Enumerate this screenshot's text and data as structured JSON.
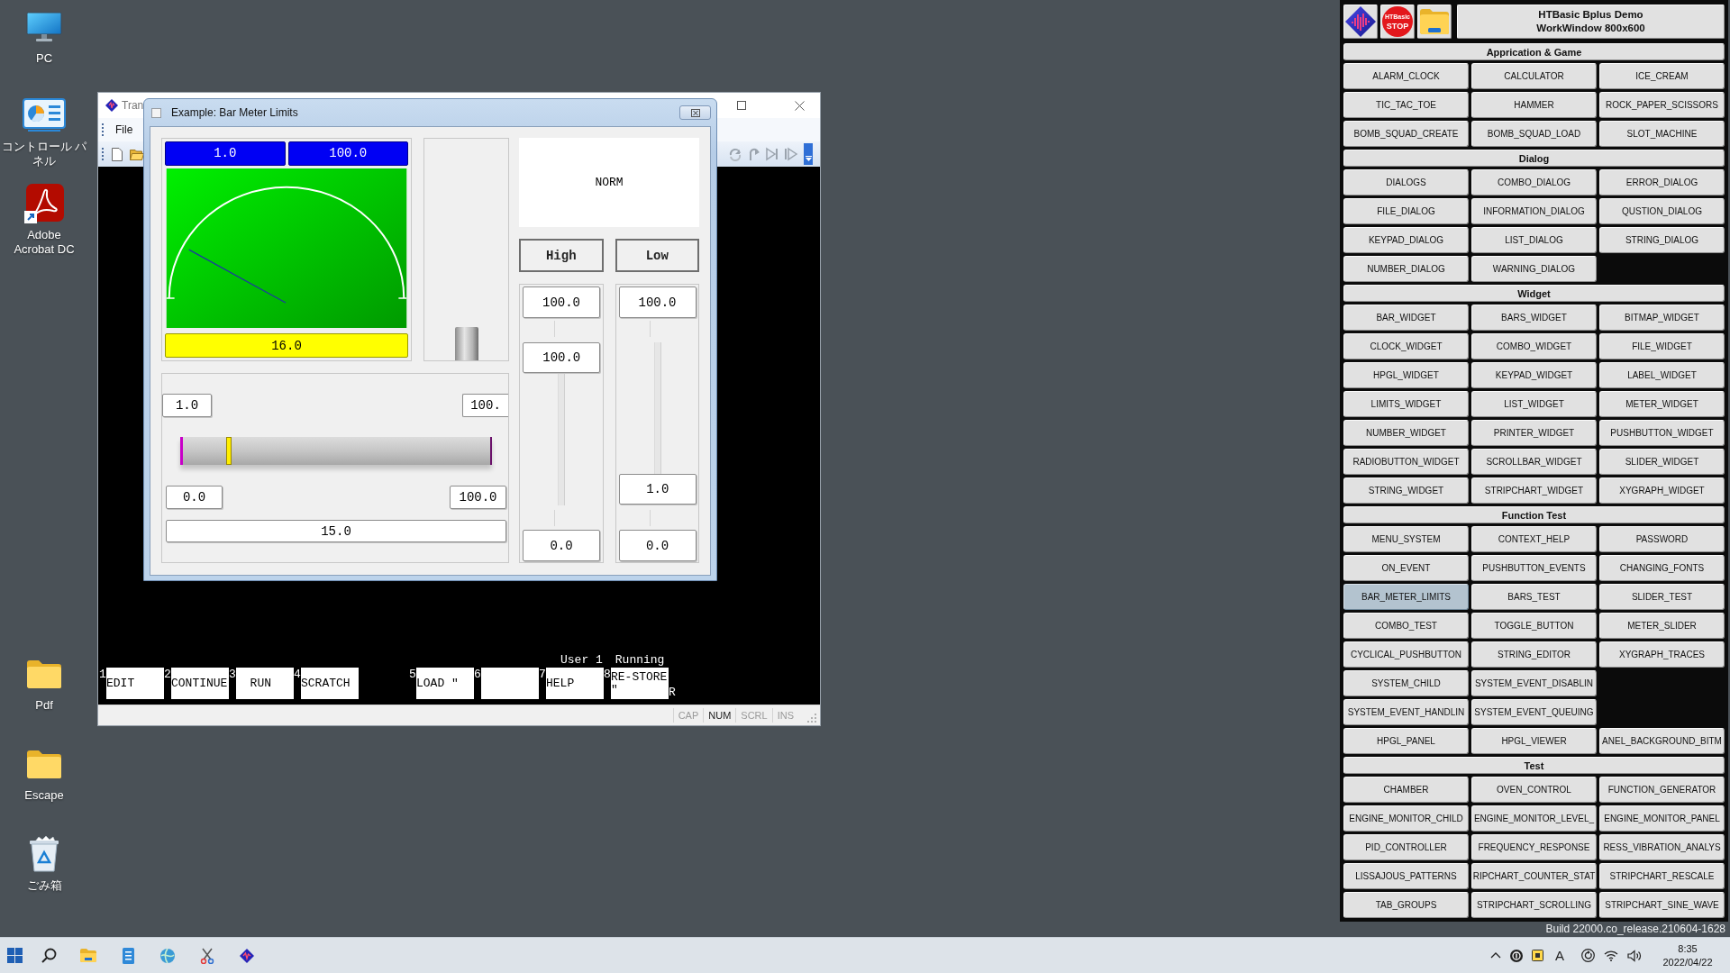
{
  "desktop_icons_top": [
    {
      "kind": "computer",
      "label_lines": [
        "PC"
      ]
    },
    {
      "kind": "control-panel",
      "label_lines": [
        "コントロール パ",
        "ネル"
      ]
    },
    {
      "kind": "app-shortcut",
      "label_lines": [
        "Adobe",
        "Acrobat DC"
      ]
    }
  ],
  "desktop_icons_bottom": [
    {
      "kind": "folder",
      "label_lines": [
        "Pdf"
      ]
    },
    {
      "kind": "folder",
      "label_lines": [
        "Escape"
      ]
    },
    {
      "kind": "recycle-bin",
      "label_lines": [
        "ごみ箱"
      ]
    }
  ],
  "main_window": {
    "title": "Tran",
    "menu": [
      "File"
    ],
    "run_status": [
      "User 1",
      "Running"
    ],
    "softkey_groups": [
      [
        {
          "number": "1",
          "lines": [
            "EDIT"
          ]
        },
        {
          "number": "2",
          "lines": [
            "CONTINUE"
          ]
        },
        {
          "number": "3",
          "lines": [
            "  RUN"
          ]
        },
        {
          "number": "4",
          "lines": [
            "SCRATCH"
          ]
        }
      ],
      [
        {
          "number": "5",
          "lines": [
            "LOAD \""
          ]
        },
        {
          "number": "6"
        },
        {
          "number": "7",
          "lines": [
            "HELP"
          ]
        },
        {
          "number": "8",
          "lines": [
            "RE-STORE",
            "\""
          ]
        }
      ]
    ],
    "run_marker": "R",
    "status_indicators": [
      {
        "label": "CAP",
        "on": false
      },
      {
        "label": "NUM",
        "on": true
      },
      {
        "label": "SCRL",
        "on": false
      },
      {
        "label": "INS",
        "on": false
      }
    ]
  },
  "dialog": {
    "title": "Example: Bar Meter Limits",
    "meter": {
      "low_limit": "1.0",
      "high_limit": "100.0",
      "level": 0.16,
      "reading": "16.0"
    },
    "bar": {
      "level": 0.15
    },
    "status": "NORM",
    "limit_columns": [
      {
        "button": "High",
        "max": "100.0",
        "value": "100.0",
        "level": 1,
        "min": "0.0"
      },
      {
        "button": "Low",
        "max": "100.0",
        "value": "1.0",
        "level": 0.01,
        "min": "0.0"
      }
    ],
    "slider": {
      "low_limit": "1.0",
      "high_limit": "100.",
      "level": 0.15,
      "min": "0.0",
      "max": "100.0",
      "reading": "15.0"
    }
  },
  "launcher": {
    "stop_lines": [
      "HTBasic",
      "STOP"
    ],
    "title_lines": [
      "HTBasic Bplus Demo",
      "WorkWindow 800x600"
    ],
    "sections": [
      {
        "title": "Apprication & Game",
        "rows": [
          [
            {
              "label": "ALARM_CLOCK",
              "selected": false
            },
            {
              "label": "CALCULATOR",
              "selected": false
            },
            {
              "label": "ICE_CREAM",
              "selected": false
            }
          ],
          [
            {
              "label": "TIC_TAC_TOE",
              "selected": false
            },
            {
              "label": "HAMMER",
              "selected": false
            },
            {
              "label": "ROCK_PAPER_SCISSORS",
              "selected": false
            }
          ],
          [
            {
              "label": "BOMB_SQUAD_CREATE",
              "selected": false
            },
            {
              "label": "BOMB_SQUAD_LOAD",
              "selected": false
            },
            {
              "label": "SLOT_MACHINE",
              "selected": false
            }
          ]
        ]
      },
      {
        "title": "Dialog",
        "rows": [
          [
            {
              "label": "DIALOGS",
              "selected": false
            },
            {
              "label": "COMBO_DIALOG",
              "selected": false
            },
            {
              "label": "ERROR_DIALOG",
              "selected": false
            }
          ],
          [
            {
              "label": "FILE_DIALOG",
              "selected": false
            },
            {
              "label": "INFORMATION_DIALOG",
              "selected": false
            },
            {
              "label": "QUSTION_DIALOG",
              "selected": false
            }
          ],
          [
            {
              "label": "KEYPAD_DIALOG",
              "selected": false
            },
            {
              "label": "LIST_DIALOG",
              "selected": false
            },
            {
              "label": "STRING_DIALOG",
              "selected": false
            }
          ],
          [
            {
              "label": "NUMBER_DIALOG",
              "selected": false
            },
            {
              "label": "WARNING_DIALOG",
              "selected": false
            }
          ]
        ]
      },
      {
        "title": "Widget",
        "rows": [
          [
            {
              "label": "BAR_WIDGET",
              "selected": false
            },
            {
              "label": "BARS_WIDGET",
              "selected": false
            },
            {
              "label": "BITMAP_WIDGET",
              "selected": false
            }
          ],
          [
            {
              "label": "CLOCK_WIDGET",
              "selected": false
            },
            {
              "label": "COMBO_WIDGET",
              "selected": false
            },
            {
              "label": "FILE_WIDGET",
              "selected": false
            }
          ],
          [
            {
              "label": "HPGL_WIDGET",
              "selected": false
            },
            {
              "label": "KEYPAD_WIDGET",
              "selected": false
            },
            {
              "label": "LABEL_WIDGET",
              "selected": false
            }
          ],
          [
            {
              "label": "LIMITS_WIDGET",
              "selected": false
            },
            {
              "label": "LIST_WIDGET",
              "selected": false
            },
            {
              "label": "METER_WIDGET",
              "selected": false
            }
          ],
          [
            {
              "label": "NUMBER_WIDGET",
              "selected": false
            },
            {
              "label": "PRINTER_WIDGET",
              "selected": false
            },
            {
              "label": "PUSHBUTTON_WIDGET",
              "selected": false
            }
          ],
          [
            {
              "label": "RADIOBUTTON_WIDGET",
              "selected": false
            },
            {
              "label": "SCROLLBAR_WIDGET",
              "selected": false
            },
            {
              "label": "SLIDER_WIDGET",
              "selected": false
            }
          ],
          [
            {
              "label": "STRING_WIDGET",
              "selected": false
            },
            {
              "label": "STRIPCHART_WIDGET",
              "selected": false
            },
            {
              "label": "XYGRAPH_WIDGET",
              "selected": false
            }
          ]
        ]
      },
      {
        "title": "Function Test",
        "rows": [
          [
            {
              "label": "MENU_SYSTEM",
              "selected": false
            },
            {
              "label": "CONTEXT_HELP",
              "selected": false
            },
            {
              "label": "PASSWORD",
              "selected": false
            }
          ],
          [
            {
              "label": "ON_EVENT",
              "selected": false
            },
            {
              "label": "PUSHBUTTON_EVENTS",
              "selected": false
            },
            {
              "label": "CHANGING_FONTS",
              "selected": false
            }
          ],
          [
            {
              "label": "BAR_METER_LIMITS",
              "selected": true
            },
            {
              "label": "BARS_TEST",
              "selected": false
            },
            {
              "label": "SLIDER_TEST",
              "selected": false
            }
          ],
          [
            {
              "label": "COMBO_TEST",
              "selected": false
            },
            {
              "label": "TOGGLE_BUTTON",
              "selected": false
            },
            {
              "label": "METER_SLIDER",
              "selected": false
            }
          ],
          [
            {
              "label": "CYCLICAL_PUSHBUTTON",
              "selected": false
            },
            {
              "label": "STRING_EDITOR",
              "selected": false
            },
            {
              "label": "XYGRAPH_TRACES",
              "selected": false
            }
          ],
          [
            {
              "label": "SYSTEM_CHILD",
              "selected": false
            },
            {
              "label": "SYSTEM_EVENT_DISABLIN",
              "selected": false
            }
          ],
          [
            {
              "label": "SYSTEM_EVENT_HANDLIN",
              "selected": false
            },
            {
              "label": "SYSTEM_EVENT_QUEUING",
              "selected": false
            }
          ],
          [
            {
              "label": "HPGL_PANEL",
              "selected": false
            },
            {
              "label": "HPGL_VIEWER",
              "selected": false
            },
            {
              "label": "ANEL_BACKGROUND_BITM",
              "selected": false
            }
          ]
        ]
      },
      {
        "title": "Test",
        "rows": [
          [
            {
              "label": "CHAMBER",
              "selected": false
            },
            {
              "label": "OVEN_CONTROL",
              "selected": false
            },
            {
              "label": "FUNCTION_GENERATOR",
              "selected": false
            }
          ],
          [
            {
              "label": "ENGINE_MONITOR_CHILD",
              "selected": false
            },
            {
              "label": "ENGINE_MONITOR_LEVEL_",
              "selected": false
            },
            {
              "label": "ENGINE_MONITOR_PANEL",
              "selected": false
            }
          ],
          [
            {
              "label": "PID_CONTROLLER",
              "selected": false
            },
            {
              "label": "FREQUENCY_RESPONSE",
              "selected": false
            },
            {
              "label": "RESS_VIBRATION_ANALYS",
              "selected": false
            }
          ],
          [
            {
              "label": "LISSAJOUS_PATTERNS",
              "selected": false
            },
            {
              "label": "RIPCHART_COUNTER_STAT",
              "selected": false
            },
            {
              "label": "STRIPCHART_RESCALE",
              "selected": false
            }
          ],
          [
            {
              "label": "TAB_GROUPS",
              "selected": false
            },
            {
              "label": "STRIPCHART_SCROLLING",
              "selected": false
            },
            {
              "label": "STRIPCHART_SINE_WAVE",
              "selected": false
            }
          ]
        ]
      }
    ]
  },
  "build_text": "Build 22000.co_release.210604-1628",
  "taskbar": {
    "ime_indicator": "A",
    "time": "8:35",
    "date": "2022/04/22"
  }
}
